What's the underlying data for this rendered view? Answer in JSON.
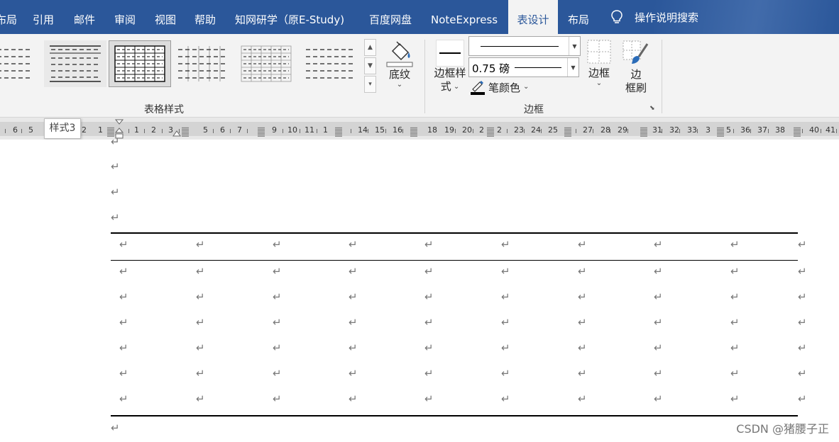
{
  "tabs": [
    {
      "label": "布局",
      "name": "tab-layout-left"
    },
    {
      "label": "引用",
      "name": "tab-references"
    },
    {
      "label": "邮件",
      "name": "tab-mailings"
    },
    {
      "label": "审阅",
      "name": "tab-review"
    },
    {
      "label": "视图",
      "name": "tab-view"
    },
    {
      "label": "帮助",
      "name": "tab-help"
    },
    {
      "label": "知网研学（原E-Study)",
      "name": "tab-cnki"
    },
    {
      "label": "百度网盘",
      "name": "tab-baidu-netdisk"
    },
    {
      "label": "NoteExpress",
      "name": "tab-noteexpress"
    },
    {
      "label": "表设计",
      "name": "tab-table-design",
      "active": true
    },
    {
      "label": "布局",
      "name": "tab-table-layout"
    }
  ],
  "tell_me": {
    "label": "操作说明搜索",
    "icon": "lightbulb-icon"
  },
  "table_styles": {
    "group_label": "表格样式",
    "selected_style_index": 2,
    "tooltip": "样式3"
  },
  "shading": {
    "label": "底纹",
    "icon": "paint-bucket-icon"
  },
  "borders_group": {
    "group_label": "边框",
    "border_styles_label_line1": "边框样",
    "border_styles_label_line2": "式",
    "pen_weight": "0.75 磅",
    "pen_color_label": "笔颜色",
    "borders_label": "边框",
    "border_painter_line1": "边",
    "border_painter_line2": "框刷"
  },
  "ruler": {
    "left_numbers": [
      "6",
      "5",
      "2",
      "1"
    ],
    "right_numbers": [
      "1",
      "2",
      "3",
      "5",
      "6",
      "7",
      "9",
      "10",
      "11",
      "1",
      "14",
      "15",
      "16",
      "18",
      "19",
      "20",
      "2",
      "2",
      "23",
      "24",
      "25",
      "27",
      "28",
      "29",
      "31",
      "32",
      "33",
      "3",
      "5",
      "36",
      "37",
      "38",
      "40",
      "41"
    ]
  },
  "document": {
    "table_columns": 10,
    "table_rows": 7,
    "paragraph_mark": "↵"
  },
  "watermark": "CSDN @猪腰子正",
  "colors": {
    "ribbon_blue": "#2b579a",
    "ribbon_bg": "#f3f3f3",
    "ruler_bg": "#d4d4d4"
  }
}
